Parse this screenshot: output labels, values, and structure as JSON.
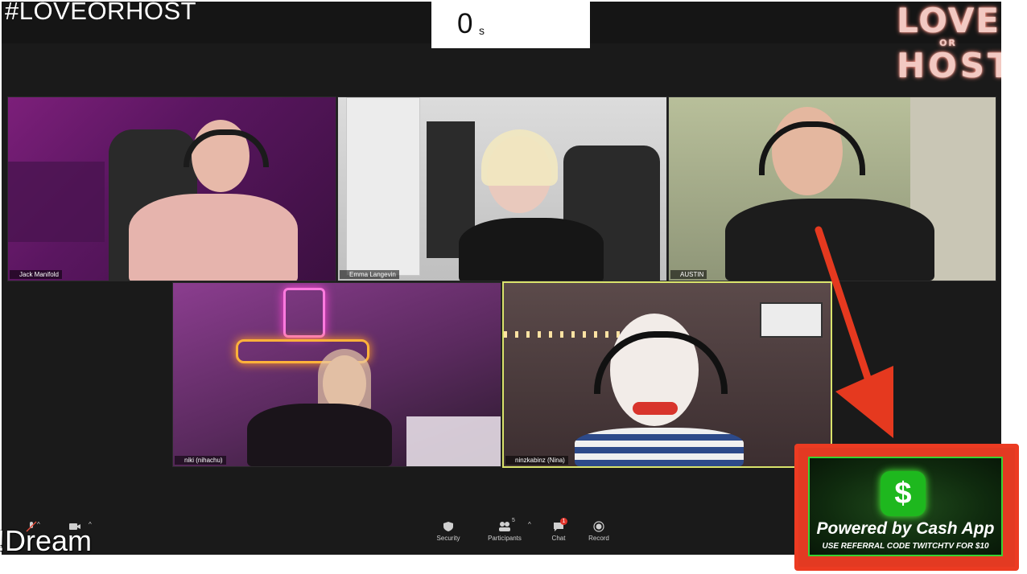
{
  "overlay": {
    "hashtag": "#LOVEORHOST",
    "timer_value": "0",
    "timer_unit": "s",
    "logo_line1": "LOVE",
    "logo_line2": "OR",
    "logo_line3": "HOST",
    "viewer_command": "!Dream"
  },
  "participants": [
    {
      "name": "Jack Manifold"
    },
    {
      "name": "Emma Langevin"
    },
    {
      "name": "AUSTIN"
    },
    {
      "name": "niki (nihachu)"
    },
    {
      "name": "ninzkabinz (Nina)"
    }
  ],
  "toolbar": {
    "security_label": "Security",
    "participants_label": "Participants",
    "participants_count": "5",
    "chat_label": "Chat",
    "chat_badge": "1",
    "record_label": "Record"
  },
  "sponsor": {
    "icon": "cash-app-dollar-icon",
    "symbol": "$",
    "title": "Powered by Cash App",
    "subtitle": "USE REFERRAL CODE TWITCHTV FOR $10"
  },
  "colors": {
    "arrow": "#e5391f",
    "active_speaker_border": "#d9e36b",
    "cash_green": "#1eb81e"
  }
}
